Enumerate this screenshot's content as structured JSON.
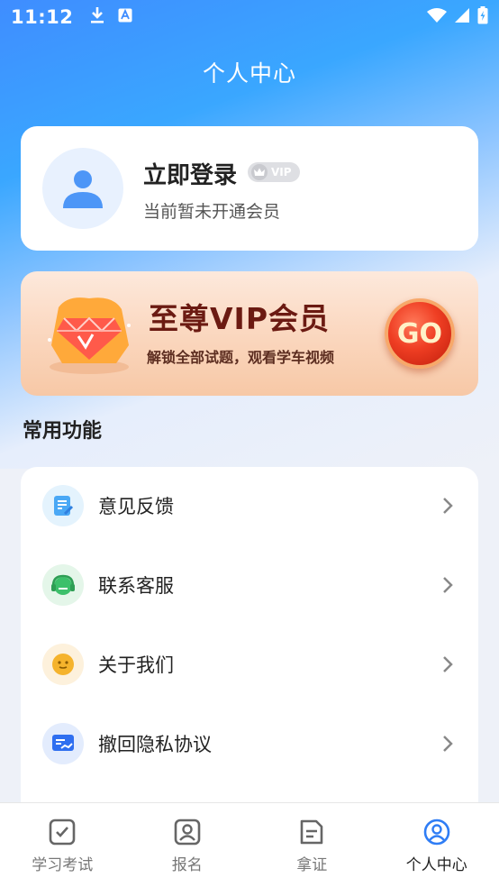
{
  "status_bar": {
    "time": "11:12",
    "icons": [
      "download-icon",
      "a-icon",
      "wifi-icon",
      "signal-icon",
      "battery-icon"
    ]
  },
  "header": {
    "title": "个人中心"
  },
  "profile": {
    "login_label": "立即登录",
    "vip_badge": "VIP",
    "member_status": "当前暂未开通会员"
  },
  "vip_banner": {
    "title": "至尊VIP会员",
    "subtitle": "解锁全部试题，观看学车视频",
    "go_label": "GO"
  },
  "section": {
    "title": "常用功能"
  },
  "functions": [
    {
      "label": "意见反馈",
      "icon": "feedback-icon",
      "color": "#4aa8f5"
    },
    {
      "label": "联系客服",
      "icon": "headset-icon",
      "color": "#3cc06a"
    },
    {
      "label": "关于我们",
      "icon": "smiley-icon",
      "color": "#f5b32c"
    },
    {
      "label": "撤回隐私协议",
      "icon": "revoke-icon",
      "color": "#2f6ff0"
    }
  ],
  "tabs": [
    {
      "label": "学习考试",
      "icon": "exam-icon",
      "active": false
    },
    {
      "label": "报名",
      "icon": "signup-icon",
      "active": false
    },
    {
      "label": "拿证",
      "icon": "certificate-icon",
      "active": false
    },
    {
      "label": "个人中心",
      "icon": "profile-icon",
      "active": true
    }
  ],
  "colors": {
    "accent": "#3aa7ff",
    "active_tab": "#2f7df5"
  }
}
